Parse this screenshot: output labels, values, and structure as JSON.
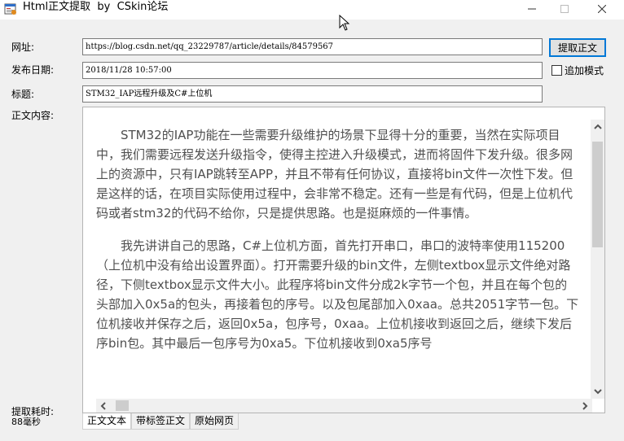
{
  "window": {
    "title": "Html正文提取  by  CSkin论坛",
    "minimize_glyph": "—",
    "maximize_glyph": "☐",
    "close_glyph": "✕"
  },
  "form": {
    "url_label": "网址:",
    "url_value": "https://blog.csdn.net/qq_23229787/article/details/84579567",
    "date_label": "发布日期:",
    "date_value": "2018/11/28 10:57:00",
    "title_label": "标题:",
    "title_value": "STM32_IAP远程升级及C#上位机",
    "content_label": "正文内容:",
    "extract_button": "提取正文",
    "append_mode_label": "追加模式",
    "append_mode_checked": false
  },
  "content": {
    "paragraphs": [
      "STM32的IAP功能在一些需要升级维护的场景下显得十分的重要，当然在实际项目中，我们需要远程发送升级指令，使得主控进入升级模式，进而将固件下发升级。很多网上的资源中，只有IAP跳转至APP，并且不带有任何协议，直接将bin文件一次性下发。但是这样的话，在项目实际使用过程中，会非常不稳定。还有一些是有代码，但是上位机代码或者stm32的代码不给你，只是提供思路。也是挺麻烦的一件事情。",
      "我先讲讲自己的思路，C#上位机方面，首先打开串口，串口的波特率使用115200（上位机中没有给出设置界面）。打开需要升级的bin文件，左侧textbox显示文件绝对路径，下侧textbox显示文件大小。此程序将bin文件分成2k字节一个包，并且在每个包的头部加入0x5a的包头，再接着包的序号。以及包尾部加入0xaa。总共2051字节一包。下位机接收并保存之后，返回0x5a，包序号，0xaa。上位机接收到返回之后，继续下发后序bin包。其中最后一包序号为0xa5。下位机接收到0xa5序号"
    ]
  },
  "tabs": [
    {
      "label": "正文文本"
    },
    {
      "label": "带标签正文"
    },
    {
      "label": "原始网页"
    }
  ],
  "status": {
    "elapsed_label": "提取耗时:",
    "elapsed_value": "88毫秒"
  },
  "colors": {
    "content_text": "#4f4f4f",
    "button_border": "#0078d7",
    "window_bg": "#f0f0f0"
  }
}
